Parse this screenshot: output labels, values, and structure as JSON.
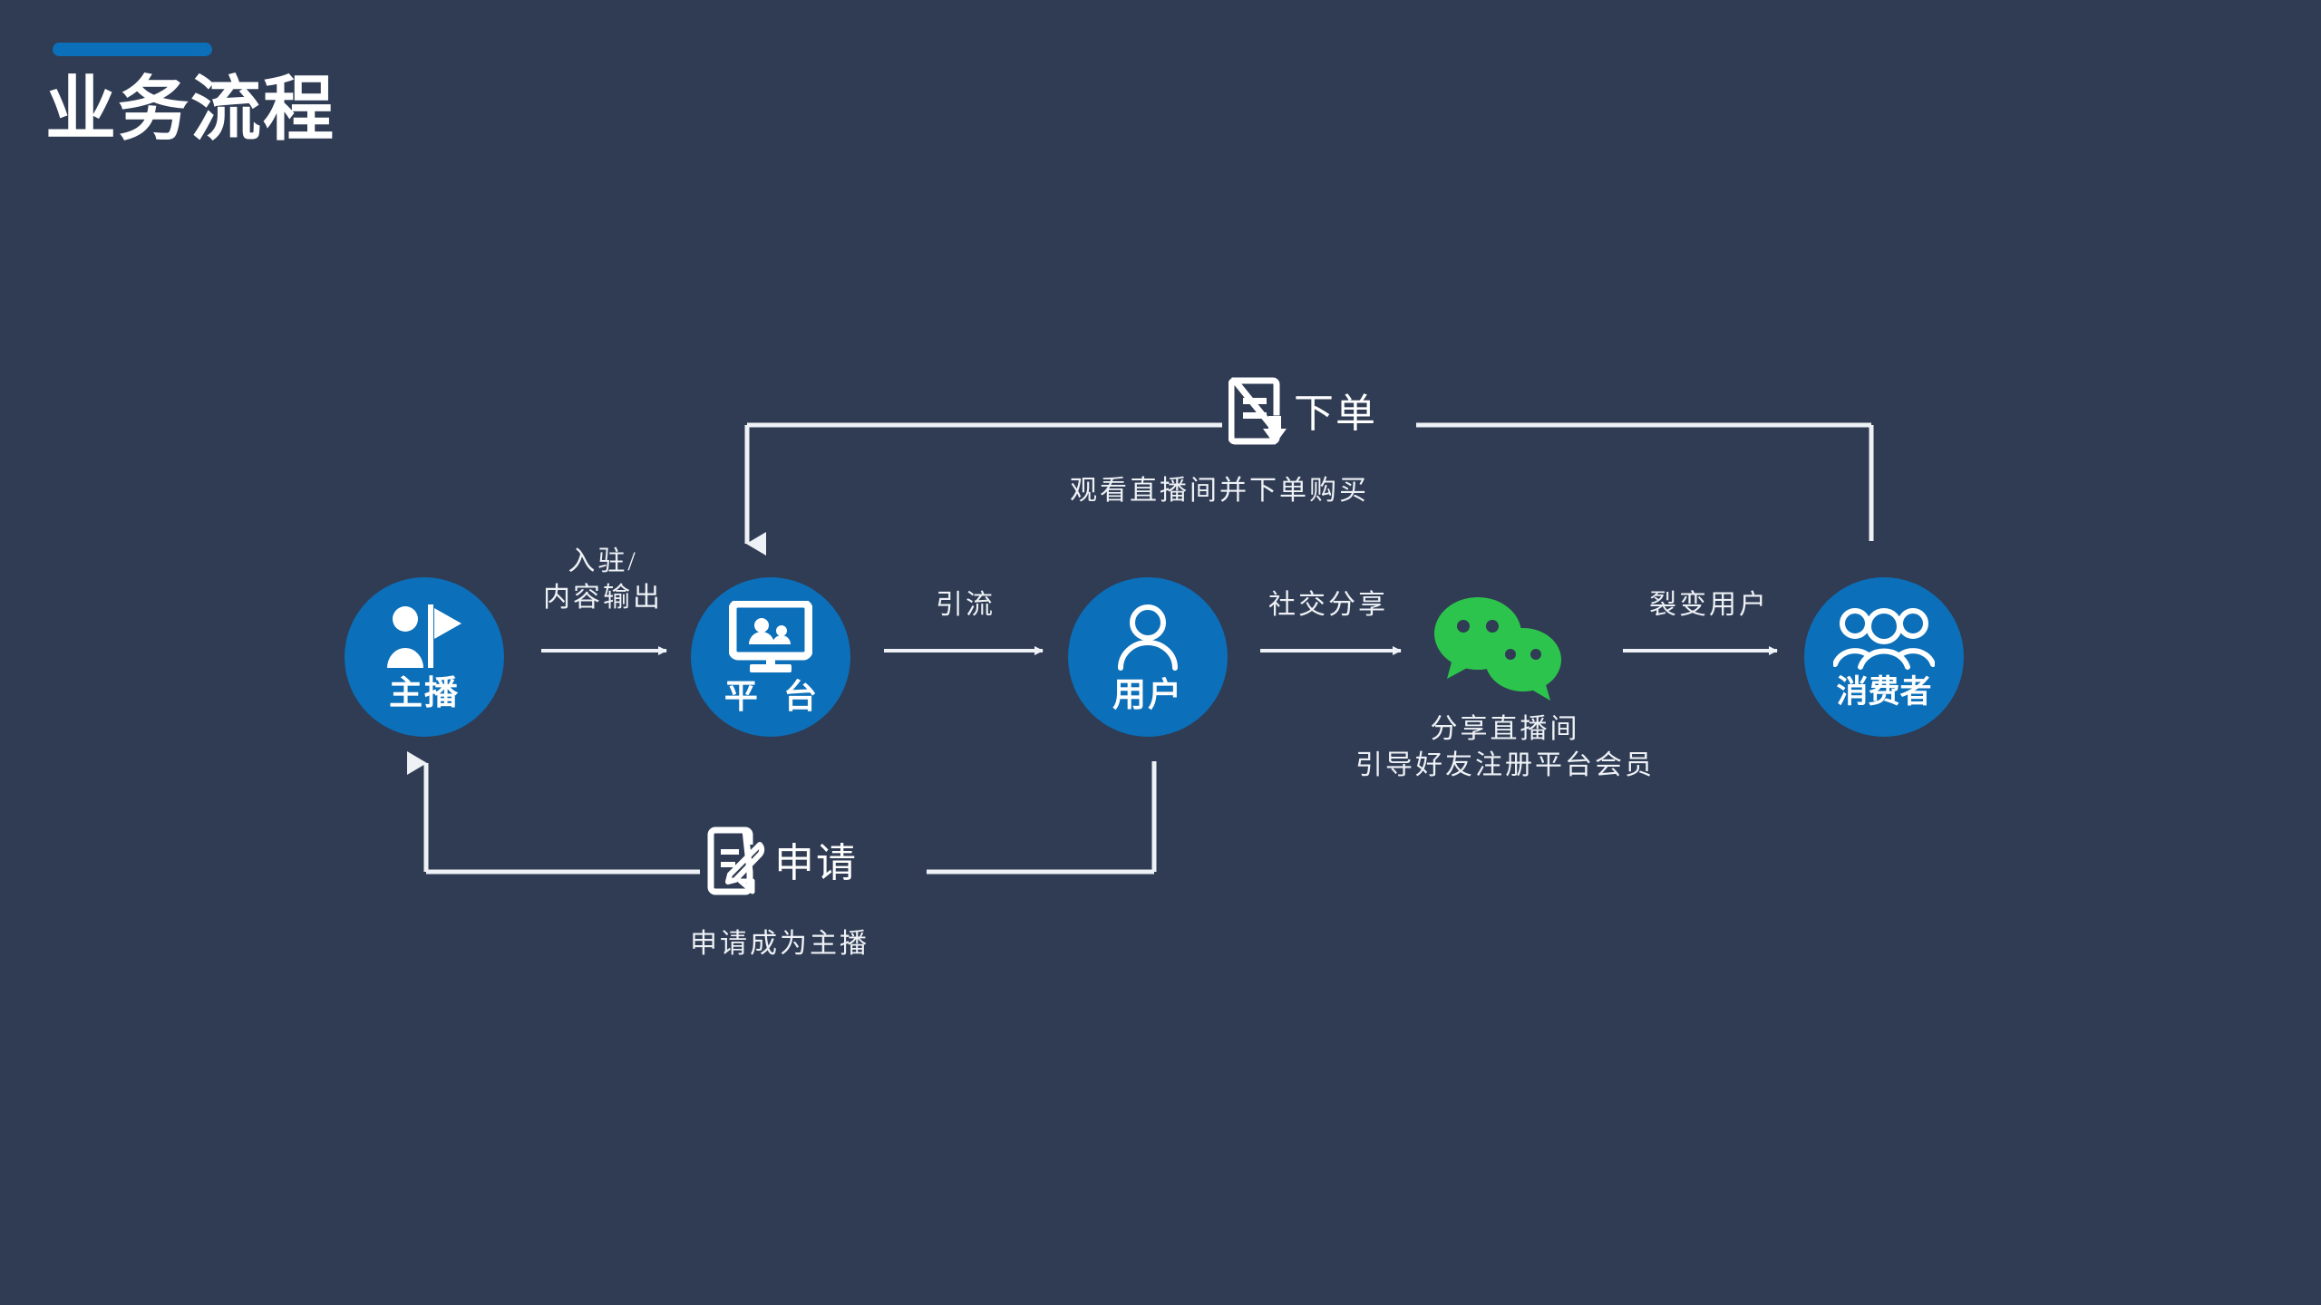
{
  "header": {
    "title": "业务流程",
    "accent_color": "#0c6fb9"
  },
  "theme": {
    "background": "#2f3c54",
    "node_blue": "#0c6fb9",
    "line_white": "#eef1f5",
    "wechat_green": "#2dc44d",
    "text_white": "#ffffff"
  },
  "nodes": [
    {
      "id": "anchor",
      "label": "主播",
      "icon": "person-with-flag-icon"
    },
    {
      "id": "platform",
      "label": "平 台",
      "icon": "monitor-broadcast-icon"
    },
    {
      "id": "user",
      "label": "用户",
      "icon": "person-outline-icon"
    },
    {
      "id": "consumer",
      "label": "消费者",
      "icon": "people-group-icon"
    }
  ],
  "wechat": {
    "icon": "wechat-icon",
    "color": "#2dc44d"
  },
  "flow_labels": {
    "entry": "入驻/\n内容输出",
    "entry_line1": "入驻/",
    "entry_line2": "内容输出",
    "drainage": "引流",
    "social_share": "社交分享",
    "fission": "裂变用户",
    "watch_and_order": "观看直播间并下单购买",
    "share_line1": "分享直播间",
    "share_line2": "引导好友注册平台会员",
    "apply_sub": "申请成为主播"
  },
  "badges": {
    "order": {
      "word": "下单",
      "icon": "document-download-icon"
    },
    "apply": {
      "word": "申请",
      "icon": "document-edit-icon"
    }
  },
  "arrows": [
    {
      "id": "anchor-to-platform",
      "direction": "right"
    },
    {
      "id": "platform-to-user",
      "direction": "right"
    },
    {
      "id": "user-to-wechat",
      "direction": "right"
    },
    {
      "id": "wechat-to-consumer",
      "direction": "right"
    },
    {
      "id": "consumer-to-platform",
      "direction": "down"
    },
    {
      "id": "user-to-anchor",
      "direction": "up"
    }
  ]
}
